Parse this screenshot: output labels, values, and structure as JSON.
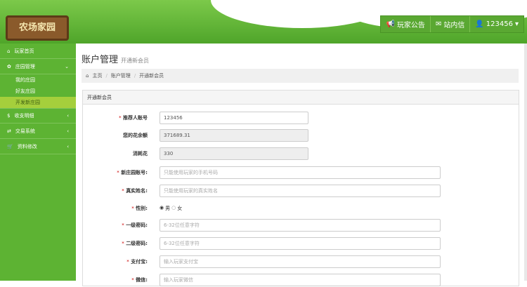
{
  "header": {
    "logo_text": "农场家园",
    "buttons": [
      {
        "icon": "bullhorn-icon",
        "label": "玩家公告"
      },
      {
        "icon": "envelope-icon",
        "label": "站内信"
      },
      {
        "icon": "user-icon",
        "label": "123456"
      }
    ]
  },
  "sidebar": {
    "items": [
      {
        "label": "玩家首页",
        "icon": "home-icon"
      },
      {
        "label": "庄园管理",
        "icon": "gift-icon"
      },
      {
        "label": "收支明细",
        "icon": "dollar-icon"
      },
      {
        "label": "交易系统",
        "icon": "exchange-icon"
      },
      {
        "label": "资料修改",
        "icon": "cart-icon"
      }
    ],
    "subitems": [
      "我的庄园",
      "好友庄园",
      "开发新庄园"
    ]
  },
  "page": {
    "title": "账户管理",
    "subtitle": "开通新会员"
  },
  "breadcrumb": [
    "主页",
    "账户管理",
    "开通新会员"
  ],
  "panel": {
    "title": "开通新会员"
  },
  "form": [
    {
      "label": "推荐人账号",
      "value": "123456"
    },
    {
      "label": "您的花余额",
      "value": "371689.31"
    },
    {
      "label": "消耗花",
      "value": "330"
    },
    {
      "label": "新庄园账号:",
      "placeholder": "只能使用玩家的手机号码"
    },
    {
      "label": "真实姓名:",
      "placeholder": "只能使用玩家的真实姓名"
    },
    {
      "label": "性别:",
      "male": "男",
      "female": "女"
    },
    {
      "label": "一级密码:",
      "placeholder": "6-32位任意字符"
    },
    {
      "label": "二级密码:",
      "placeholder": "6-32位任意字符"
    },
    {
      "label": "支付宝:",
      "placeholder": "输入玩家支付宝"
    },
    {
      "label": "微信:",
      "placeholder": "输入玩家微信"
    }
  ],
  "required_mark": "*"
}
